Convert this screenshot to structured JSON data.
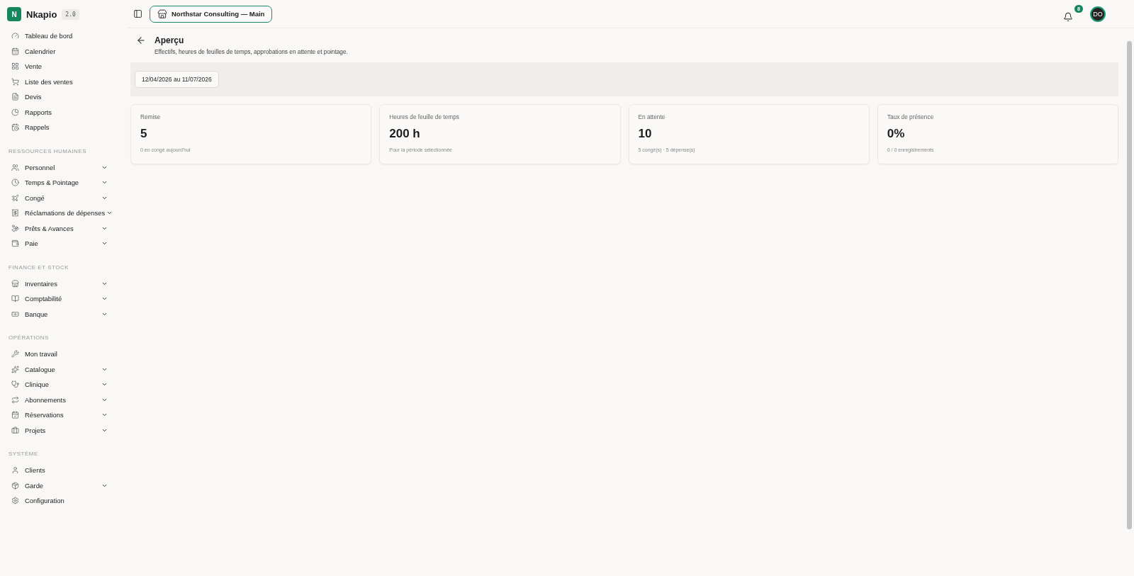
{
  "brand": {
    "logo": "N",
    "name": "Nkapio",
    "version": "2.0"
  },
  "sidebar": {
    "sections": [
      {
        "items": [
          {
            "label": "Tableau de bord",
            "kind": "link"
          },
          {
            "label": "Calendrier",
            "kind": "link"
          },
          {
            "label": "Vente",
            "kind": "link"
          },
          {
            "label": "Liste des ventes",
            "kind": "link"
          },
          {
            "label": "Devis",
            "kind": "link"
          },
          {
            "label": "Rapports",
            "kind": "link"
          },
          {
            "label": "Rappels",
            "kind": "link"
          }
        ]
      },
      {
        "title": "RESSOURCES HUMAINES",
        "items": [
          {
            "label": "Personnel",
            "kind": "group"
          },
          {
            "label": "Temps & Pointage",
            "kind": "group"
          },
          {
            "label": "Congé",
            "kind": "group"
          },
          {
            "label": "Réclamations de dépenses",
            "kind": "group"
          },
          {
            "label": "Prêts & Avances",
            "kind": "group"
          },
          {
            "label": "Paie",
            "kind": "group"
          }
        ]
      },
      {
        "title": "FINANCE ET STOCK",
        "items": [
          {
            "label": "Inventaires",
            "kind": "group"
          },
          {
            "label": "Comptabilité",
            "kind": "group"
          },
          {
            "label": "Banque",
            "kind": "group"
          }
        ]
      },
      {
        "title": "OPÉRATIONS",
        "items": [
          {
            "label": "Mon travail",
            "kind": "link"
          },
          {
            "label": "Catalogue",
            "kind": "group"
          },
          {
            "label": "Clinique",
            "kind": "group"
          },
          {
            "label": "Abonnements",
            "kind": "group"
          },
          {
            "label": "Réservations",
            "kind": "group"
          },
          {
            "label": "Projets",
            "kind": "group"
          }
        ]
      },
      {
        "title": "SYSTÈME",
        "items": [
          {
            "label": "Clients",
            "kind": "link"
          },
          {
            "label": "Garde",
            "kind": "group"
          },
          {
            "label": "Configuration",
            "kind": "link"
          }
        ]
      }
    ]
  },
  "topbar": {
    "workspace": "Northstar Consulting — Main",
    "notifications": "8",
    "avatar": "DO"
  },
  "page": {
    "title": "Aperçu",
    "subtitle": "Effectifs, heures de feuilles de temps, approbations en attente et pointage.",
    "date_range": "12/04/2026 au 11/07/2026"
  },
  "stats": [
    {
      "label": "Remise",
      "value": "5",
      "note": "0 en congé aujourd'hui"
    },
    {
      "label": "Heures de feuille de temps",
      "value": "200 h",
      "note": "Pour la période sélectionnée"
    },
    {
      "label": "En attente",
      "value": "10",
      "note": "5 congé(s) · 5 dépense(s)"
    },
    {
      "label": "Taux de présence",
      "value": "0%",
      "note": "0 / 0 enregistrements"
    }
  ]
}
